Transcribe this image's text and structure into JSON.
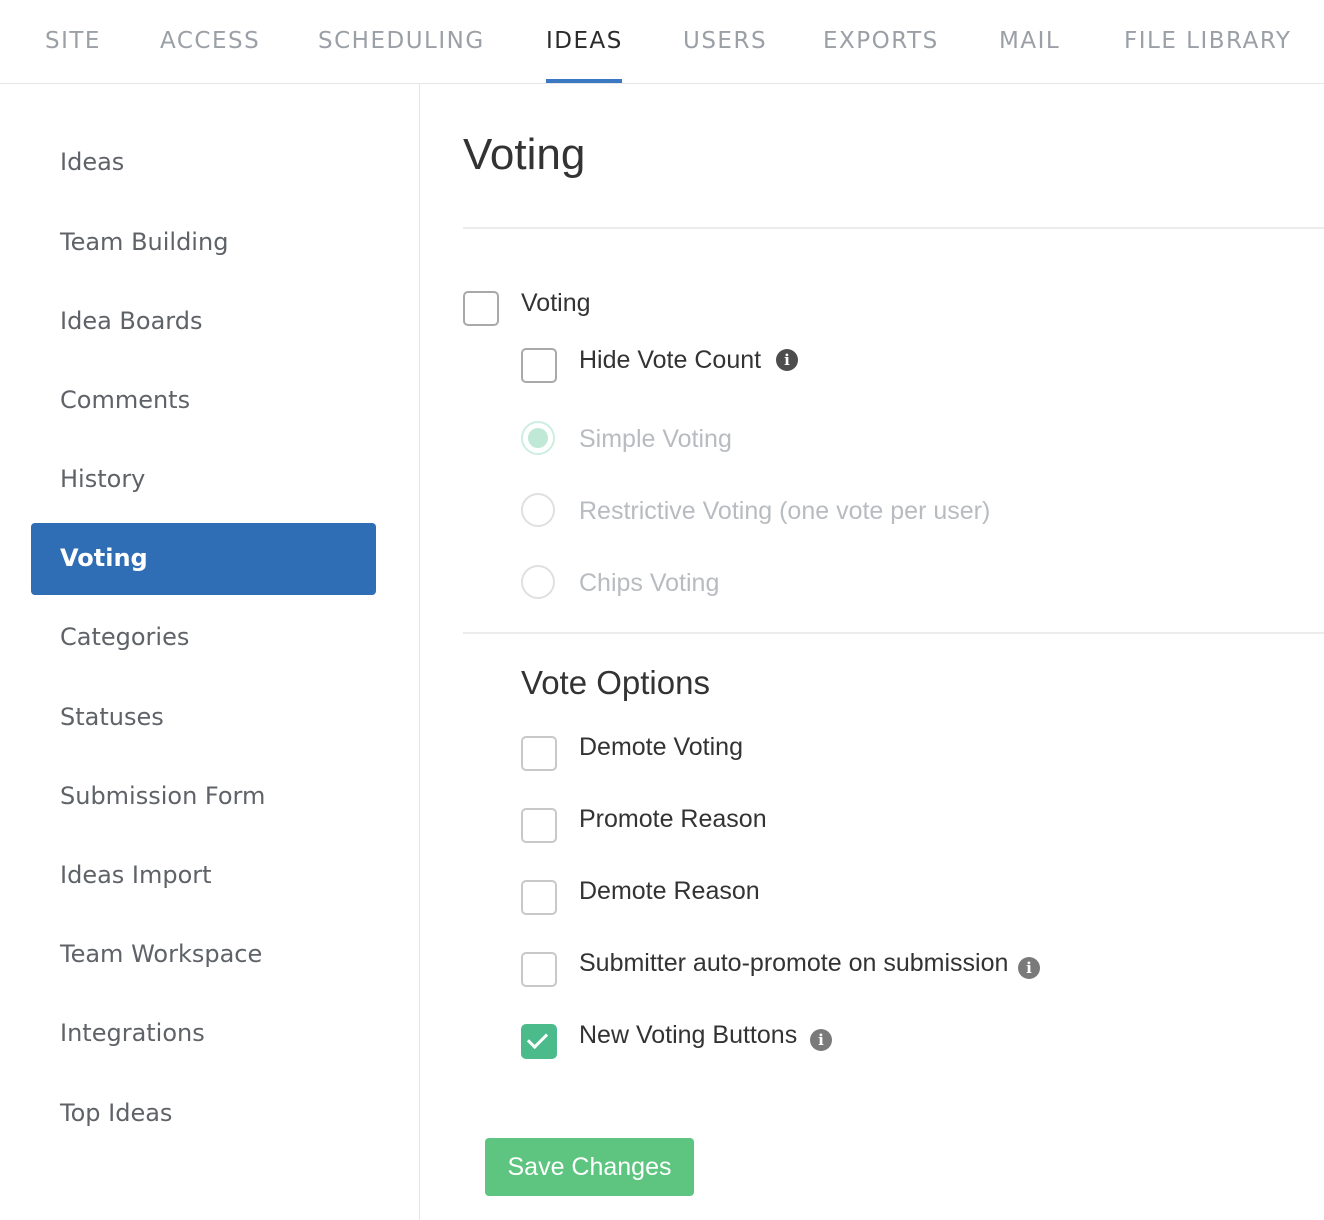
{
  "top_nav": {
    "tabs": [
      {
        "label": "SITE"
      },
      {
        "label": "ACCESS"
      },
      {
        "label": "SCHEDULING"
      },
      {
        "label": "IDEAS"
      },
      {
        "label": "USERS"
      },
      {
        "label": "EXPORTS"
      },
      {
        "label": "MAIL"
      },
      {
        "label": "FILE LIBRARY"
      }
    ],
    "active": "IDEAS"
  },
  "sidebar": {
    "items": [
      {
        "label": "Ideas"
      },
      {
        "label": "Team Building"
      },
      {
        "label": "Idea Boards"
      },
      {
        "label": "Comments"
      },
      {
        "label": "History"
      },
      {
        "label": "Voting"
      },
      {
        "label": "Categories"
      },
      {
        "label": "Statuses"
      },
      {
        "label": "Submission Form"
      },
      {
        "label": "Ideas Import"
      },
      {
        "label": "Team Workspace"
      },
      {
        "label": "Integrations"
      },
      {
        "label": "Top Ideas"
      }
    ],
    "active": "Voting"
  },
  "main": {
    "title": "Voting",
    "voting_toggle": {
      "label": "Voting",
      "checked": false
    },
    "hide_vote_count": {
      "label": "Hide Vote Count",
      "checked": false,
      "icon": "info-icon"
    },
    "voting_types": [
      {
        "label": "Simple Voting",
        "selected": true,
        "disabled": true
      },
      {
        "label": "Restrictive Voting (one vote per user)",
        "selected": false,
        "disabled": true
      },
      {
        "label": "Chips Voting",
        "selected": false,
        "disabled": true
      }
    ],
    "vote_options": {
      "title": "Vote Options",
      "options": [
        {
          "label": "Demote Voting",
          "checked": false
        },
        {
          "label": "Promote Reason",
          "checked": false
        },
        {
          "label": "Demote Reason",
          "checked": false
        },
        {
          "label": "Submitter auto-promote on submission",
          "checked": false,
          "icon": "info-icon"
        },
        {
          "label": "New Voting Buttons",
          "checked": true,
          "icon": "info-icon"
        }
      ]
    },
    "save_label": "Save Changes"
  },
  "colors": {
    "accent": "#2f6db5",
    "tab_underline": "#3a78c2",
    "checked": "#4cbb8b",
    "save_button": "#5dc57f"
  }
}
